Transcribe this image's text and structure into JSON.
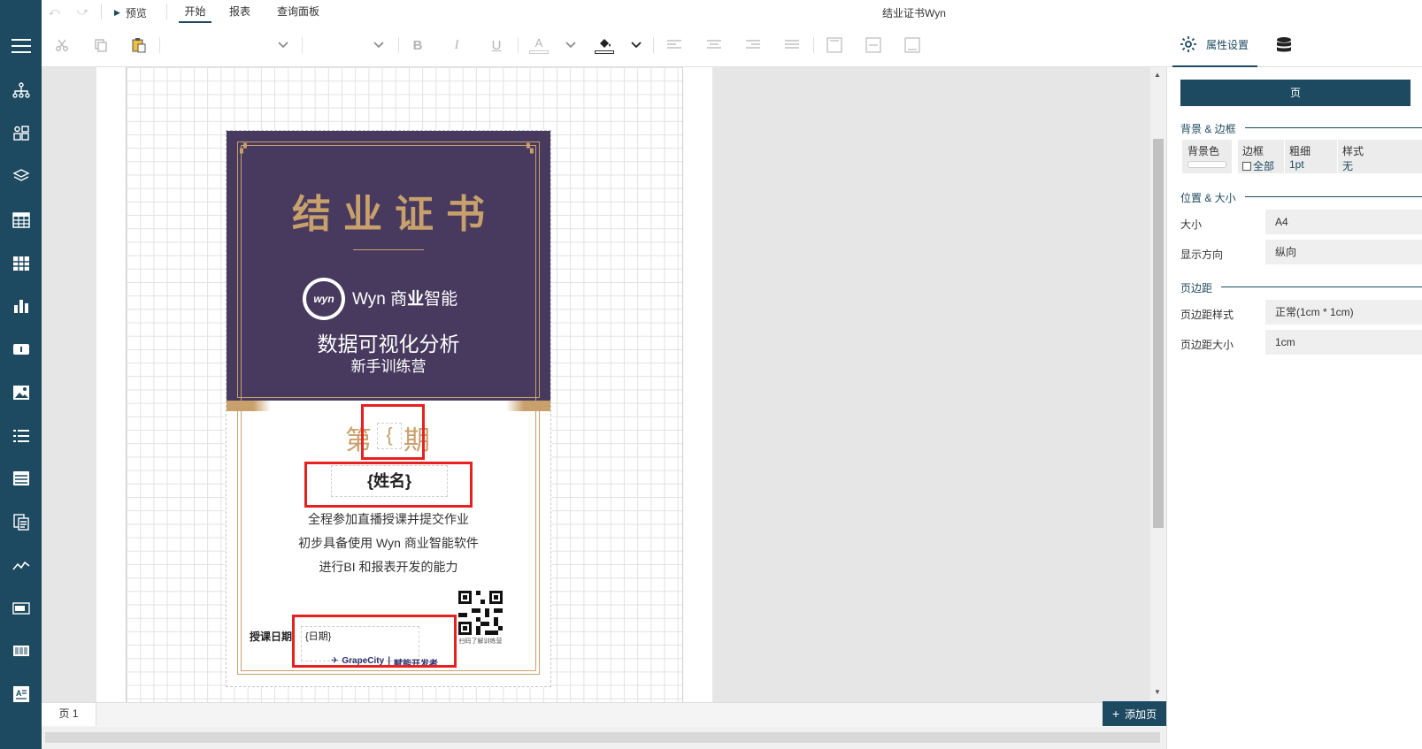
{
  "window_title": "结业证书Wyn",
  "topbar": {
    "preview_label": "预览",
    "tabs": [
      {
        "label": "开始",
        "active": true
      },
      {
        "label": "报表",
        "active": false
      },
      {
        "label": "查询面板",
        "active": false
      }
    ]
  },
  "certificate": {
    "title": "结业证书",
    "logo_text_prefix": "Wyn 商",
    "logo_text_bold": "业",
    "logo_text_suffix": "智能",
    "logo_badge": "wyn",
    "subtitle": "数据可视化分析",
    "subtitle2": "新手训练营",
    "period_prefix": "第",
    "period_placeholder": "{",
    "period_suffix": "期",
    "name_placeholder": "{姓名}",
    "body_lines": [
      "全程参加直播授课并提交作业",
      "初步具备使用 Wyn 商业智能软件",
      "进行BI 和报表开发的能力"
    ],
    "date_label": "授课日期:",
    "date_placeholder": "{日期}",
    "qr_caption": "扫码了解训练营",
    "footer_brand": "GrapeCity",
    "footer_slogan": "赋能开发者"
  },
  "bottombar": {
    "page_tab": "页 1",
    "add_page_label": "添加页"
  },
  "panel": {
    "tab_label": "属性设置",
    "header_button": "页",
    "sections": {
      "background_border": "背景 & 边框",
      "position_size": "位置 & 大小",
      "margins": "页边距"
    },
    "bg_color_label": "背景色",
    "border_label": "边框",
    "border_all_label": "全部",
    "thickness_label": "粗细",
    "thickness_value": "1pt",
    "style_label": "样式",
    "style_value": "无",
    "size_label": "大小",
    "size_value": "A4",
    "orientation_label": "显示方向",
    "orientation_value": "纵向",
    "margin_style_label": "页边距样式",
    "margin_style_value": "正常(1cm * 1cm)",
    "margin_size_label": "页边距大小",
    "margin_size_value": "1cm"
  },
  "colors": {
    "sidebar": "#1d4a60",
    "certificate_purple": "#473a5e",
    "gold": "#c8a06c",
    "highlight_red": "#e8201f"
  }
}
